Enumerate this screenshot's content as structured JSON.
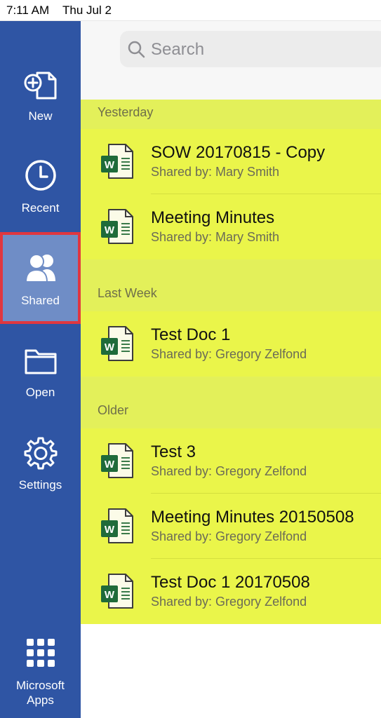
{
  "status_bar": {
    "time": "7:11 AM",
    "date": "Thu Jul 2"
  },
  "sidebar": {
    "items": [
      {
        "label": "New",
        "icon": "new-document-icon"
      },
      {
        "label": "Recent",
        "icon": "clock-icon"
      },
      {
        "label": "Shared",
        "icon": "people-icon",
        "selected": true
      },
      {
        "label": "Open",
        "icon": "folder-icon"
      },
      {
        "label": "Settings",
        "icon": "gear-icon"
      }
    ],
    "apps": {
      "line1": "Microsoft",
      "line2": "Apps",
      "icon": "app-grid-icon"
    }
  },
  "search": {
    "placeholder": "Search"
  },
  "sections": [
    {
      "header": "Yesterday",
      "files": [
        {
          "title": "SOW 20170815 - Copy",
          "shared_by": "Shared by: Mary Smith"
        },
        {
          "title": "Meeting Minutes",
          "shared_by": "Shared by: Mary Smith"
        }
      ]
    },
    {
      "header": "Last Week",
      "files": [
        {
          "title": "Test Doc 1",
          "shared_by": "Shared by: Gregory Zelfond"
        }
      ]
    },
    {
      "header": "Older",
      "files": [
        {
          "title": "Test 3",
          "shared_by": "Shared by: Gregory Zelfond"
        },
        {
          "title": "Meeting Minutes 20150508",
          "shared_by": "Shared by: Gregory Zelfond"
        },
        {
          "title": "Test Doc 1 20170508",
          "shared_by": "Shared by: Gregory Zelfond"
        }
      ]
    }
  ],
  "colors": {
    "sidebar": "#2f55a4",
    "selected": "#6f8dc6",
    "highlight_border": "#e0373f",
    "row_background": "#eaf54a",
    "word_green": "#1f6b3a"
  },
  "doc_icon_letter": "W"
}
